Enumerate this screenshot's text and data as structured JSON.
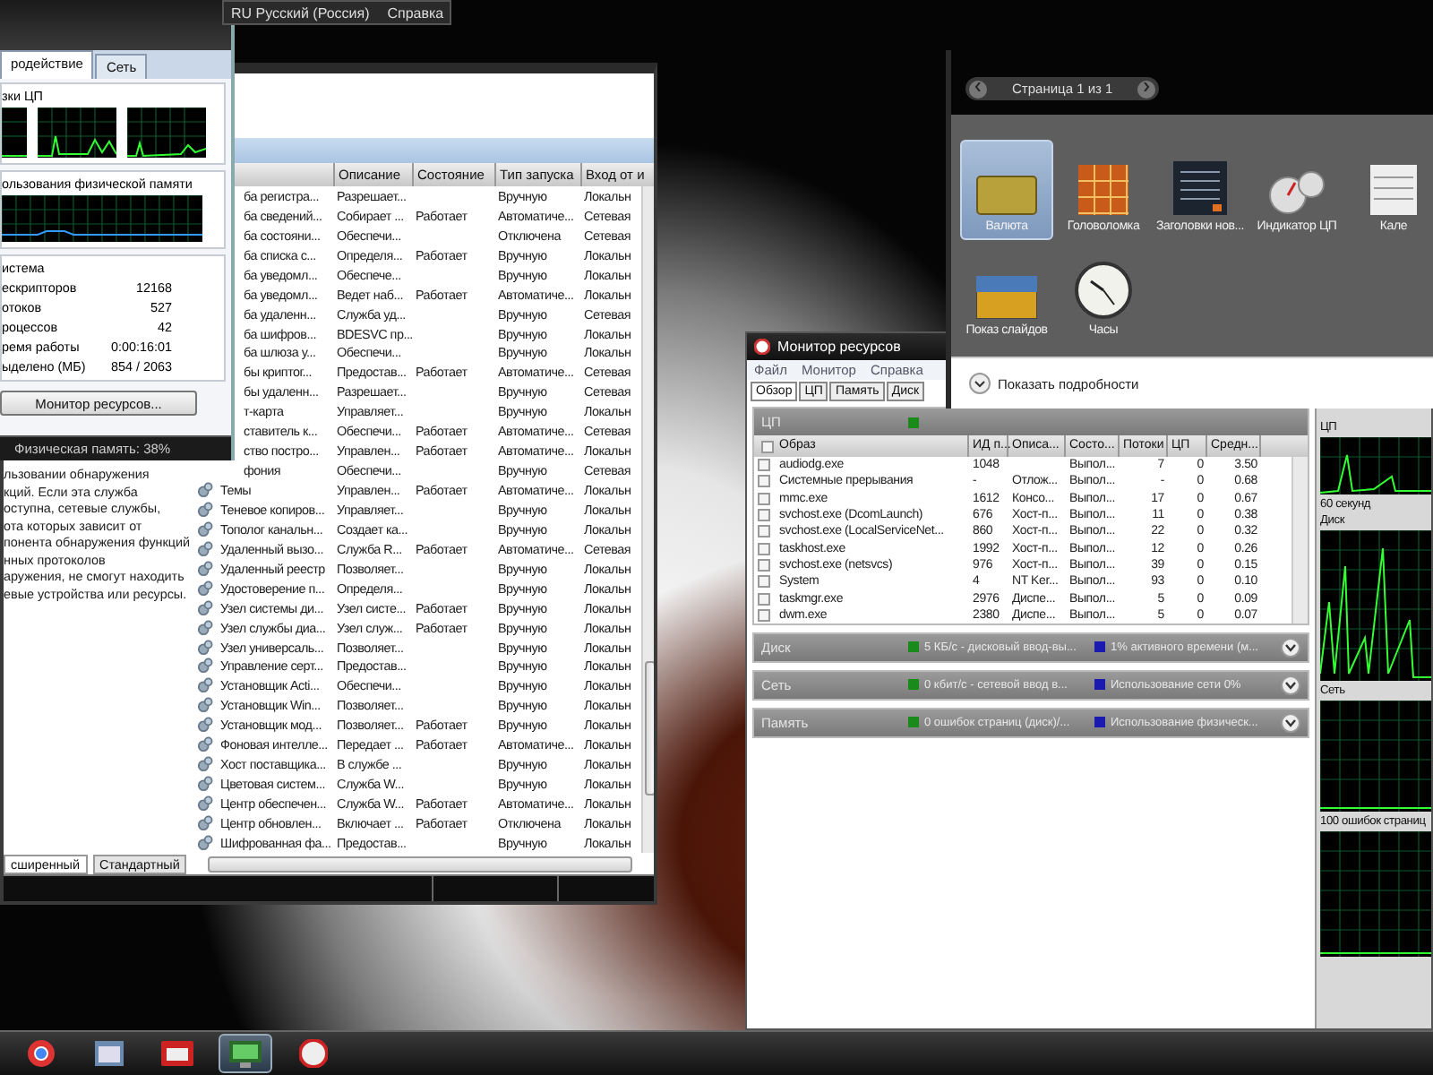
{
  "language_bar": {
    "language": "RU Русский (Россия)",
    "help": "Справка"
  },
  "task_manager": {
    "tabs": [
      {
        "label": "родействие",
        "selected": true
      },
      {
        "label": "Сеть",
        "selected": false
      }
    ],
    "cpu_group": "зки ЦП",
    "memory_group": "ользования физической памяти",
    "system_group": "истема",
    "stats": [
      {
        "label": "ескрипторов",
        "value": "12168"
      },
      {
        "label": "отоков",
        "value": "527"
      },
      {
        "label": "роцессов",
        "value": "42"
      },
      {
        "label": "ремя работы",
        "value": "0:00:16:01"
      },
      {
        "label": "ыделено (МБ)",
        "value": "854 / 2063"
      }
    ],
    "button": "Монитор ресурсов...",
    "status": "Физическая память: 38%"
  },
  "services": {
    "description_lines": [
      "льзовании обнаружения",
      "кций. Если эта служба",
      "оступна, сетевые службы,",
      "ота которых зависит от",
      "понента обнаружения функций",
      "нных протоколов",
      "аружения, не смогут находить",
      "евые устройства или ресурсы."
    ],
    "columns": [
      "Описание",
      "Состояние",
      "Тип запуска",
      "Вход от и"
    ],
    "rows": [
      {
        "kind": "partial",
        "name": "ба регистра...",
        "description": "Разрешает...",
        "state": "",
        "startup": "Вручную",
        "logon": "Локальн"
      },
      {
        "kind": "partial",
        "name": "ба сведений...",
        "description": "Собирает ...",
        "state": "Работает",
        "startup": "Автоматиче...",
        "logon": "Сетевая"
      },
      {
        "kind": "partial",
        "name": "ба состояни...",
        "description": "Обеспечи...",
        "state": "",
        "startup": "Отключена",
        "logon": "Сетевая"
      },
      {
        "kind": "partial",
        "name": "ба списка с...",
        "description": "Определя...",
        "state": "Работает",
        "startup": "Вручную",
        "logon": "Локальн"
      },
      {
        "kind": "partial",
        "name": "ба уведомл...",
        "description": "Обеспече...",
        "state": "",
        "startup": "Вручную",
        "logon": "Локальн"
      },
      {
        "kind": "partial",
        "name": "ба уведомл...",
        "description": "Ведет наб...",
        "state": "Работает",
        "startup": "Автоматиче...",
        "logon": "Локальн"
      },
      {
        "kind": "partial",
        "name": "ба удаленн...",
        "description": "Служба уд...",
        "state": "",
        "startup": "Вручную",
        "logon": "Сетевая"
      },
      {
        "kind": "partial",
        "name": "ба шифров...",
        "description": "BDESVC пр...",
        "state": "",
        "startup": "Вручную",
        "logon": "Локальн"
      },
      {
        "kind": "partial",
        "name": "ба шлюза у...",
        "description": "Обеспечи...",
        "state": "",
        "startup": "Вручную",
        "logon": "Локальн"
      },
      {
        "kind": "partial",
        "name": "бы криптог...",
        "description": "Предостав...",
        "state": "Работает",
        "startup": "Автоматиче...",
        "logon": "Сетевая"
      },
      {
        "kind": "partial",
        "name": "бы удаленн...",
        "description": "Разрешает...",
        "state": "",
        "startup": "Вручную",
        "logon": "Сетевая"
      },
      {
        "kind": "partial",
        "name": "т-карта",
        "description": "Управляет...",
        "state": "",
        "startup": "Вручную",
        "logon": "Локальн"
      },
      {
        "kind": "partial",
        "name": "ставитель к...",
        "description": "Обеспечи...",
        "state": "Работает",
        "startup": "Автоматиче...",
        "logon": "Сетевая"
      },
      {
        "kind": "partial",
        "name": "ство постро...",
        "description": "Управлен...",
        "state": "Работает",
        "startup": "Автоматиче...",
        "logon": "Локальн"
      },
      {
        "kind": "partial",
        "name": "фония",
        "description": "Обеспечи...",
        "state": "",
        "startup": "Вручную",
        "logon": "Сетевая"
      },
      {
        "kind": "full",
        "name": "Темы",
        "description": "Управлен...",
        "state": "Работает",
        "startup": "Автоматиче...",
        "logon": "Локальн"
      },
      {
        "kind": "full",
        "name": "Теневое копиров...",
        "description": "Управляет...",
        "state": "",
        "startup": "Вручную",
        "logon": "Локальн"
      },
      {
        "kind": "full",
        "name": "Тополог канальн...",
        "description": "Создает ка...",
        "state": "",
        "startup": "Вручную",
        "logon": "Локальн"
      },
      {
        "kind": "full",
        "name": "Удаленный вызо...",
        "description": "Служба R...",
        "state": "Работает",
        "startup": "Автоматиче...",
        "logon": "Сетевая"
      },
      {
        "kind": "full",
        "name": "Удаленный реестр",
        "description": "Позволяет...",
        "state": "",
        "startup": "Вручную",
        "logon": "Локальн"
      },
      {
        "kind": "full",
        "name": "Удостоверение п...",
        "description": "Определя...",
        "state": "",
        "startup": "Вручную",
        "logon": "Локальн"
      },
      {
        "kind": "full",
        "name": "Узел системы ди...",
        "description": "Узел систе...",
        "state": "Работает",
        "startup": "Вручную",
        "logon": "Локальн"
      },
      {
        "kind": "full",
        "name": "Узел службы диа...",
        "description": "Узел служ...",
        "state": "Работает",
        "startup": "Вручную",
        "logon": "Локальн"
      },
      {
        "kind": "full",
        "name": "Узел универсаль...",
        "description": "Позволяет...",
        "state": "",
        "startup": "Вручную",
        "logon": "Локальн"
      },
      {
        "kind": "full",
        "name": "Управление серт...",
        "description": "Предостав...",
        "state": "",
        "startup": "Вручную",
        "logon": "Локальн"
      },
      {
        "kind": "full",
        "name": "Установщик Acti...",
        "description": "Обеспечи...",
        "state": "",
        "startup": "Вручную",
        "logon": "Локальн"
      },
      {
        "kind": "full",
        "name": "Установщик Win...",
        "description": "Позволяет...",
        "state": "",
        "startup": "Вручную",
        "logon": "Локальн"
      },
      {
        "kind": "full",
        "name": "Установщик мод...",
        "description": "Позволяет...",
        "state": "Работает",
        "startup": "Вручную",
        "logon": "Локальн"
      },
      {
        "kind": "full",
        "name": "Фоновая интелле...",
        "description": "Передает ...",
        "state": "Работает",
        "startup": "Автоматиче...",
        "logon": "Локальн"
      },
      {
        "kind": "full",
        "name": "Хост поставщика...",
        "description": "В службе ...",
        "state": "",
        "startup": "Вручную",
        "logon": "Локальн"
      },
      {
        "kind": "full",
        "name": "Цветовая систем...",
        "description": "Служба W...",
        "state": "",
        "startup": "Вручную",
        "logon": "Локальн"
      },
      {
        "kind": "full",
        "name": "Центр обеспечен...",
        "description": "Служба W...",
        "state": "Работает",
        "startup": "Автоматиче...",
        "logon": "Локальн"
      },
      {
        "kind": "full",
        "name": "Центр обновлен...",
        "description": "Включает ...",
        "state": "Работает",
        "startup": "Отключена",
        "logon": "Локальн"
      },
      {
        "kind": "full",
        "name": "Шифрованная фа...",
        "description": "Предостав...",
        "state": "",
        "startup": "Вручную",
        "logon": "Локальн"
      }
    ],
    "view_tabs": [
      {
        "label": "сширенный",
        "selected": true
      },
      {
        "label": "Стандартный",
        "selected": false
      }
    ]
  },
  "gadgets": {
    "page": "Страница 1 из 1",
    "items": [
      {
        "kind": "currency",
        "label": "Валюта",
        "selected": true
      },
      {
        "kind": "puzzle",
        "label": "Головоломка",
        "selected": false
      },
      {
        "kind": "headlines",
        "label": "Заголовки нов...",
        "selected": false
      },
      {
        "kind": "gauge",
        "label": "Индикатор ЦП",
        "selected": false
      },
      {
        "kind": "calendar",
        "label": "Кале",
        "selected": false
      },
      {
        "kind": "slideshow",
        "label": "Показ слайдов",
        "selected": false
      },
      {
        "kind": "clock",
        "label": "Часы",
        "selected": false
      }
    ],
    "details": "Показать подробности"
  },
  "resource_monitor": {
    "title": "Монитор ресурсов",
    "menu": [
      "Файл",
      "Монитор",
      "Справка"
    ],
    "tabs": [
      {
        "label": "Обзор",
        "selected": true
      },
      {
        "label": "ЦП",
        "selected": false
      },
      {
        "label": "Память",
        "selected": false
      },
      {
        "label": "Диск",
        "selected": false
      }
    ],
    "cpu_label": "ЦП",
    "select_all_checked": false,
    "columns": [
      "Образ",
      "ИД п...",
      "Описа...",
      "Состо...",
      "Потоки",
      "ЦП",
      "Средн..."
    ],
    "rows": [
      {
        "checked": false,
        "cells": [
          "audiodg.exe",
          "1048",
          "",
          "Выпол...",
          "7",
          "0",
          "3.50"
        ]
      },
      {
        "checked": false,
        "cells": [
          "Системные прерывания",
          "-",
          "Отлож...",
          "Выпол...",
          "-",
          "0",
          "0.68"
        ]
      },
      {
        "checked": false,
        "cells": [
          "mmc.exe",
          "1612",
          "Консо...",
          "Выпол...",
          "17",
          "0",
          "0.67"
        ]
      },
      {
        "checked": false,
        "cells": [
          "svchost.exe (DcomLaunch)",
          "676",
          "Хост-п...",
          "Выпол...",
          "11",
          "0",
          "0.38"
        ]
      },
      {
        "checked": false,
        "cells": [
          "svchost.exe (LocalServiceNet...",
          "860",
          "Хост-п...",
          "Выпол...",
          "22",
          "0",
          "0.32"
        ]
      },
      {
        "checked": false,
        "cells": [
          "taskhost.exe",
          "1992",
          "Хост-п...",
          "Выпол...",
          "12",
          "0",
          "0.26"
        ]
      },
      {
        "checked": false,
        "cells": [
          "svchost.exe (netsvcs)",
          "976",
          "Хост-п...",
          "Выпол...",
          "39",
          "0",
          "0.15"
        ]
      },
      {
        "checked": false,
        "cells": [
          "System",
          "4",
          "NT Ker...",
          "Выпол...",
          "93",
          "0",
          "0.10"
        ]
      },
      {
        "checked": false,
        "cells": [
          "taskmgr.exe",
          "2976",
          "Диспе...",
          "Выпол...",
          "5",
          "0",
          "0.09"
        ]
      },
      {
        "checked": false,
        "cells": [
          "dwm.exe",
          "2380",
          "Диспе...",
          "Выпол...",
          "5",
          "0",
          "0.07"
        ]
      }
    ],
    "sections": [
      {
        "label": "Диск",
        "metric_1": "5 КБ/с - дисковый ввод-вы...",
        "metric_2": "1% активного времени (м..."
      },
      {
        "label": "Сеть",
        "metric_1": "0 кбит/с - сетевой ввод в...",
        "metric_2": "Использование сети 0%"
      },
      {
        "label": "Память",
        "metric_1": "0 ошибок страниц (диск)/...",
        "metric_2": "Использование физическ..."
      }
    ],
    "graphs": [
      {
        "kind": "cpu",
        "label": "ЦП",
        "caption": "60 секунд"
      },
      {
        "kind": "disk",
        "label": "Диск"
      },
      {
        "kind": "network",
        "label": "Сеть"
      },
      {
        "kind": "memory",
        "label": "100 ошибок страниц"
      }
    ]
  }
}
